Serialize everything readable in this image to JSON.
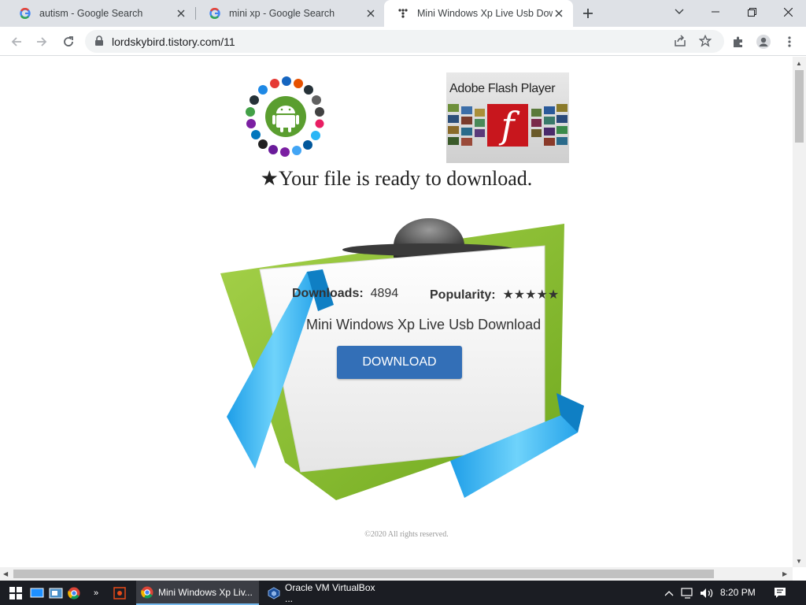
{
  "browser": {
    "tabs": [
      {
        "title": "autism - Google Search",
        "favicon": "google-g-icon"
      },
      {
        "title": "mini xp - Google Search",
        "favicon": "google-g-icon"
      },
      {
        "title": "Mini Windows Xp Live Usb Download",
        "favicon": "tistory-icon"
      }
    ],
    "active_tab": 2,
    "url": "lordskybird.tistory.com/11"
  },
  "page": {
    "flash_title": "Adobe Flash Player",
    "flash_letter": "f",
    "ready_text": "★Your file is ready to download.",
    "downloads_label": "Downloads:",
    "downloads_value": "4894",
    "popularity_label": "Popularity:",
    "popularity_stars": "★★★★★",
    "file_name": "Mini Windows Xp Live Usb Download",
    "download_button": "DOWNLOAD",
    "footer": "©2020 All rights reserved."
  },
  "taskbar": {
    "apps": [
      {
        "label": "Mini Windows Xp Liv...",
        "icon": "chrome-icon"
      },
      {
        "label": "Oracle VM VirtualBox ...",
        "icon": "virtualbox-icon"
      }
    ],
    "clock": "8:20 PM"
  },
  "colors": {
    "download_button": "#336fb7",
    "accent_blue": "#29b6f6",
    "accent_green": "#8cc63f",
    "tabstrip": "#dee1e6",
    "taskbar": "#1b1d23"
  }
}
